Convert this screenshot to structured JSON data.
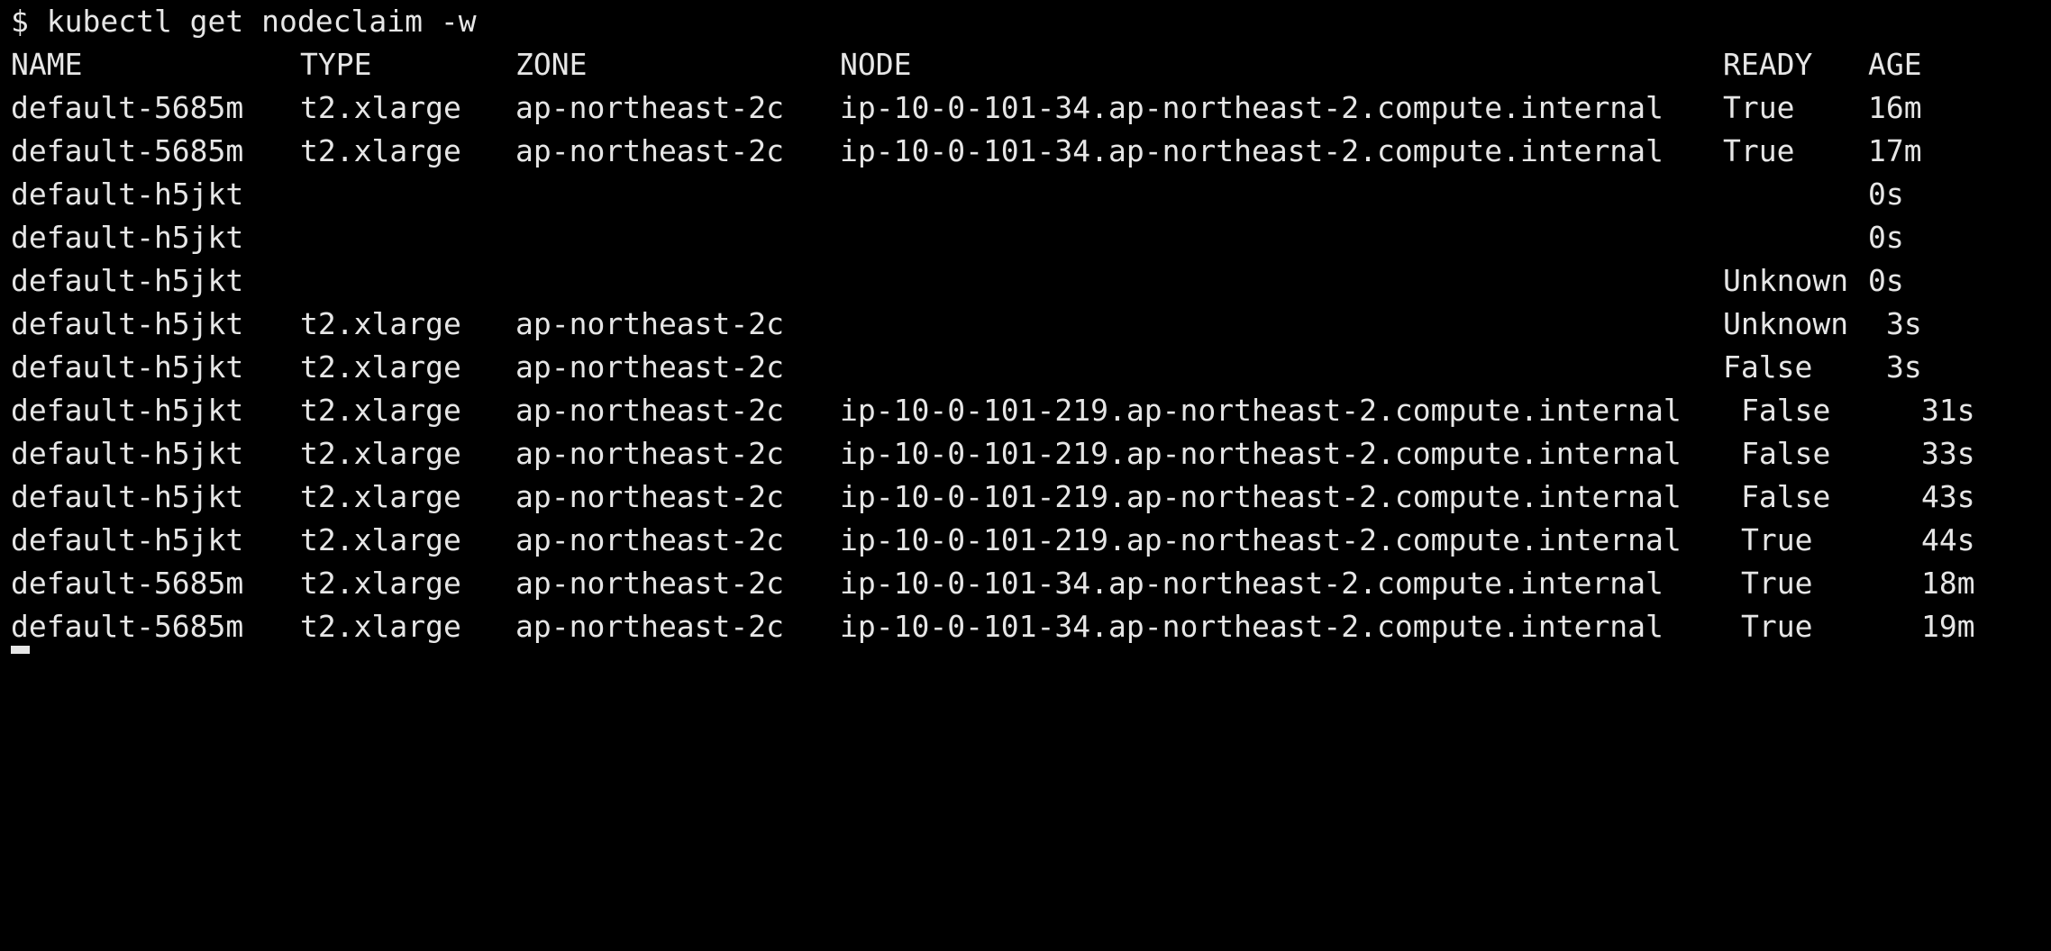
{
  "terminal": {
    "command_line": "$ kubectl get nodeclaim -w",
    "headers": {
      "name": "NAME",
      "type": "TYPE",
      "zone": "ZONE",
      "node": "NODE",
      "ready": "READY",
      "age": "AGE"
    },
    "rows": [
      {
        "name": "default-5685m",
        "type": "t2.xlarge",
        "zone": "ap-northeast-2c",
        "node": "ip-10-0-101-34.ap-northeast-2.compute.internal",
        "ready": "True",
        "age": "16m"
      },
      {
        "name": "default-5685m",
        "type": "t2.xlarge",
        "zone": "ap-northeast-2c",
        "node": "ip-10-0-101-34.ap-northeast-2.compute.internal",
        "ready": "True",
        "age": "17m"
      },
      {
        "name": "default-h5jkt",
        "type": "",
        "zone": "",
        "node": "",
        "ready": "",
        "age": "0s"
      },
      {
        "name": "default-h5jkt",
        "type": "",
        "zone": "",
        "node": "",
        "ready": "",
        "age": "0s"
      },
      {
        "name": "default-h5jkt",
        "type": "",
        "zone": "",
        "node": "",
        "ready": "Unknown",
        "age": "0s"
      },
      {
        "name": "default-h5jkt",
        "type": "t2.xlarge",
        "zone": "ap-northeast-2c",
        "node": "",
        "ready": "Unknown",
        "age": "3s"
      },
      {
        "name": "default-h5jkt",
        "type": "t2.xlarge",
        "zone": "ap-northeast-2c",
        "node": "",
        "ready": "False",
        "age": "3s"
      },
      {
        "name": "default-h5jkt",
        "type": "t2.xlarge",
        "zone": "ap-northeast-2c",
        "node": "ip-10-0-101-219.ap-northeast-2.compute.internal",
        "ready": "False",
        "age": "31s"
      },
      {
        "name": "default-h5jkt",
        "type": "t2.xlarge",
        "zone": "ap-northeast-2c",
        "node": "ip-10-0-101-219.ap-northeast-2.compute.internal",
        "ready": "False",
        "age": "33s"
      },
      {
        "name": "default-h5jkt",
        "type": "t2.xlarge",
        "zone": "ap-northeast-2c",
        "node": "ip-10-0-101-219.ap-northeast-2.compute.internal",
        "ready": "False",
        "age": "43s"
      },
      {
        "name": "default-h5jkt",
        "type": "t2.xlarge",
        "zone": "ap-northeast-2c",
        "node": "ip-10-0-101-219.ap-northeast-2.compute.internal",
        "ready": "True",
        "age": "44s"
      },
      {
        "name": "default-5685m",
        "type": "t2.xlarge",
        "zone": "ap-northeast-2c",
        "node": "ip-10-0-101-34.ap-northeast-2.compute.internal",
        "ready": "True",
        "age": "18m"
      },
      {
        "name": "default-5685m",
        "type": "t2.xlarge",
        "zone": "ap-northeast-2c",
        "node": "ip-10-0-101-34.ap-northeast-2.compute.internal",
        "ready": "True",
        "age": "19m"
      }
    ],
    "colors": {
      "background": "#000000",
      "text": "#e6e6e6"
    }
  }
}
